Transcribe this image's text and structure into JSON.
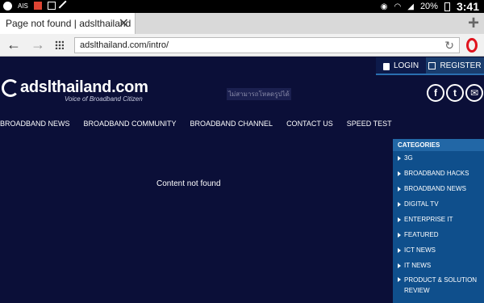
{
  "status_bar": {
    "icons_left": [
      "video-chat-icon",
      "ais-signal-icon",
      "muted-icon",
      "crossed-icon",
      "wrench-icon"
    ],
    "carrier": "AIS",
    "battery": "20%",
    "time": "3:41"
  },
  "browser": {
    "tab_title": "Page not found | adslthailand",
    "url": "adslthailand.com/intro/"
  },
  "page": {
    "login_label": "LOGIN",
    "register_label": "REGISTER",
    "logo_text": "adslthailand.com",
    "logo_tagline": "Voice of Broadband Citizen",
    "image_fallback_text": "ไม่สามารถโหลดรูปได้",
    "nav": [
      "BROADBAND NEWS",
      "BROADBAND COMMUNITY",
      "BROADBAND CHANNEL",
      "CONTACT US",
      "SPEED TEST"
    ],
    "message": "Content not found",
    "sidebar": {
      "title": "CATEGORIES",
      "items": [
        "3G",
        "BROADBAND HACKS",
        "BROADBAND NEWS",
        "DIGITAL TV",
        "ENTERPRISE IT",
        "FEATURED",
        "ICT NEWS",
        "IT NEWS",
        "PRODUCT & SOLUTION",
        "REVIEW"
      ]
    }
  },
  "colors": {
    "page_bg": "#0b0f38",
    "sidebar_bg": "#0f4f8c",
    "sidebar_head": "#2267a6",
    "opera_red": "#e0141e"
  }
}
